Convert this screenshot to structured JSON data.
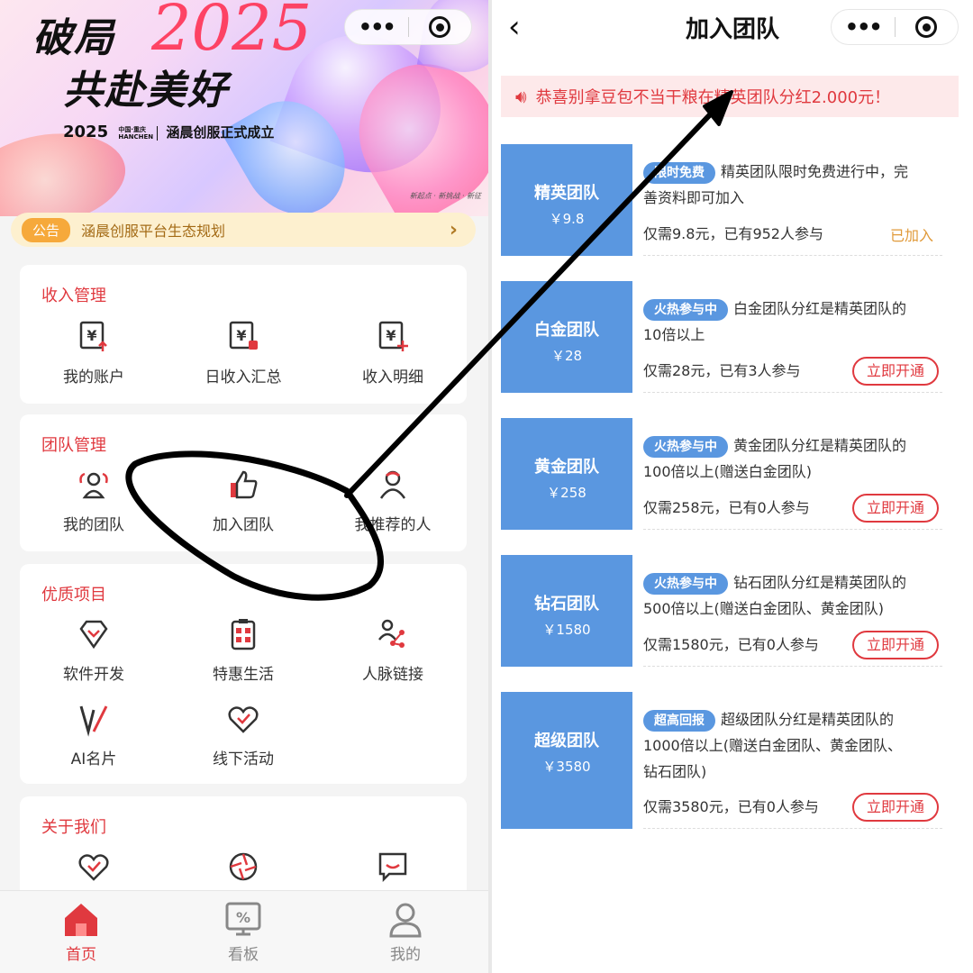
{
  "left": {
    "banner": {
      "headline_1": "破局",
      "headline_year": "2025",
      "headline_2": "共赴美好",
      "sub_year": "2025",
      "sub_brand_top": "中国·重庆",
      "sub_brand_bottom": "HANCHEN",
      "sub_text": "涵晨创服正式成立",
      "slogan": "新起点 · 新挑战 · 新征"
    },
    "notice": {
      "tag": "公告",
      "text": "涵晨创服平台生态规划",
      "arrow": "›"
    },
    "income": {
      "title": "收入管理",
      "items": [
        {
          "label": "我的账户",
          "icon": "account-yen-icon"
        },
        {
          "label": "日收入汇总",
          "icon": "daily-income-icon"
        },
        {
          "label": "收入明细",
          "icon": "income-detail-icon"
        }
      ]
    },
    "team": {
      "title": "团队管理",
      "items": [
        {
          "label": "我的团队",
          "icon": "team-icon"
        },
        {
          "label": "加入团队",
          "icon": "thumbs-up-icon"
        },
        {
          "label": "我推荐的人",
          "icon": "person-icon"
        }
      ]
    },
    "projects": {
      "title": "优质项目",
      "items": [
        {
          "label": "软件开发",
          "icon": "diamond-icon"
        },
        {
          "label": "特惠生活",
          "icon": "clipboard-icon"
        },
        {
          "label": "人脉链接",
          "icon": "network-icon"
        },
        {
          "label": "AI名片",
          "icon": "ai-card-icon"
        },
        {
          "label": "线下活动",
          "icon": "heart-check-icon"
        }
      ]
    },
    "about": {
      "title": "关于我们"
    },
    "tabbar": [
      {
        "label": "首页",
        "icon": "home-icon",
        "active": true
      },
      {
        "label": "看板",
        "icon": "dashboard-icon",
        "active": false
      },
      {
        "label": "我的",
        "icon": "profile-icon",
        "active": false
      }
    ]
  },
  "right": {
    "back": "‹",
    "title": "加入团队",
    "marquee": "恭喜别拿豆包不当干粮在精英团队分红2.000元！",
    "teams": [
      {
        "name": "精英团队",
        "price": "￥9.8",
        "badge": "限时免费",
        "desc": "精英团队限时免费进行中，完善资料即可加入",
        "meta": "仅需9.8元，已有952人参与",
        "status": "已加入"
      },
      {
        "name": "白金团队",
        "price": "￥28",
        "badge": "火热参与中",
        "desc": "白金团队分红是精英团队的10倍以上",
        "meta": "仅需28元，已有3人参与",
        "action": "立即开通"
      },
      {
        "name": "黄金团队",
        "price": "￥258",
        "badge": "火热参与中",
        "desc": "黄金团队分红是精英团队的100倍以上(赠送白金团队)",
        "meta": "仅需258元，已有0人参与",
        "action": "立即开通"
      },
      {
        "name": "钻石团队",
        "price": "￥1580",
        "badge": "火热参与中",
        "desc": "钻石团队分红是精英团队的500倍以上(赠送白金团队、黄金团队)",
        "meta": "仅需1580元，已有0人参与",
        "action": "立即开通"
      },
      {
        "name": "超级团队",
        "price": "￥3580",
        "badge": "超高回报",
        "desc": "超级团队分红是精英团队的1000倍以上(赠送白金团队、黄金团队、钻石团队)",
        "meta": "仅需3580元，已有0人参与",
        "action": "立即开通"
      }
    ]
  },
  "colors": {
    "accent_red": "#e0393f",
    "team_blue": "#5a97e0",
    "notice_orange": "#f6a93b",
    "joined_orange": "#e09a3a"
  }
}
